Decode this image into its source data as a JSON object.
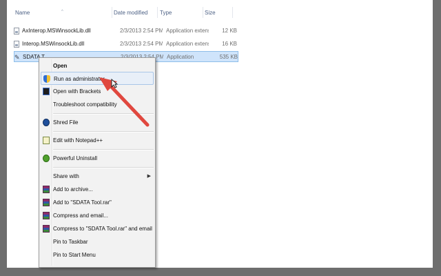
{
  "columns": {
    "name": "Name",
    "date": "Date modified",
    "type": "Type",
    "size": "Size"
  },
  "files": [
    {
      "name": "AxInterop.MSWinsockLib.dll",
      "date": "2/3/2013 2:54 PM",
      "type": "Application extens...",
      "size": "12 KB",
      "icon": "dll-file-icon",
      "selected": false
    },
    {
      "name": "Interop.MSWinsockLib.dll",
      "date": "2/3/2013 2:54 PM",
      "type": "Application extens...",
      "size": "16 KB",
      "icon": "dll-file-icon",
      "selected": false
    },
    {
      "name": "SDATA T",
      "date": "2/3/2013 2:54 PM",
      "type": "Application",
      "size": "535 KB",
      "icon": "application-icon",
      "selected": true
    }
  ],
  "context_menu": {
    "items": [
      {
        "label": "Open",
        "bold": true,
        "icon": ""
      },
      {
        "label": "Run as administrator",
        "icon": "uac-shield-icon",
        "hover": true
      },
      {
        "label": "Open with Brackets",
        "icon": "brackets-icon"
      },
      {
        "label": "Troubleshoot compatibility",
        "icon": ""
      },
      {
        "label": "Shred File",
        "icon": "shred-icon"
      },
      {
        "label": "Edit with Notepad++",
        "icon": "notepad-plus-plus-icon"
      },
      {
        "label": "Powerful Uninstall",
        "icon": "uninstall-icon"
      },
      {
        "label": "Share with",
        "icon": "",
        "submenu": true
      },
      {
        "label": "Add to archive...",
        "icon": "winrar-icon"
      },
      {
        "label": "Add to \"SDATA Tool.rar\"",
        "icon": "winrar-icon"
      },
      {
        "label": "Compress and email...",
        "icon": "winrar-icon"
      },
      {
        "label": "Compress to \"SDATA Tool.rar\" and email",
        "icon": "winrar-icon"
      },
      {
        "label": "Pin to Taskbar",
        "icon": ""
      },
      {
        "label": "Pin to Start Menu",
        "icon": ""
      }
    ]
  },
  "annotation": {
    "color": "#e0483f",
    "target": "Run as administrator"
  },
  "colors": {
    "selection": "#cfe4fb",
    "menu_bg": "#f2f2f2",
    "header_text": "#4d6185"
  }
}
